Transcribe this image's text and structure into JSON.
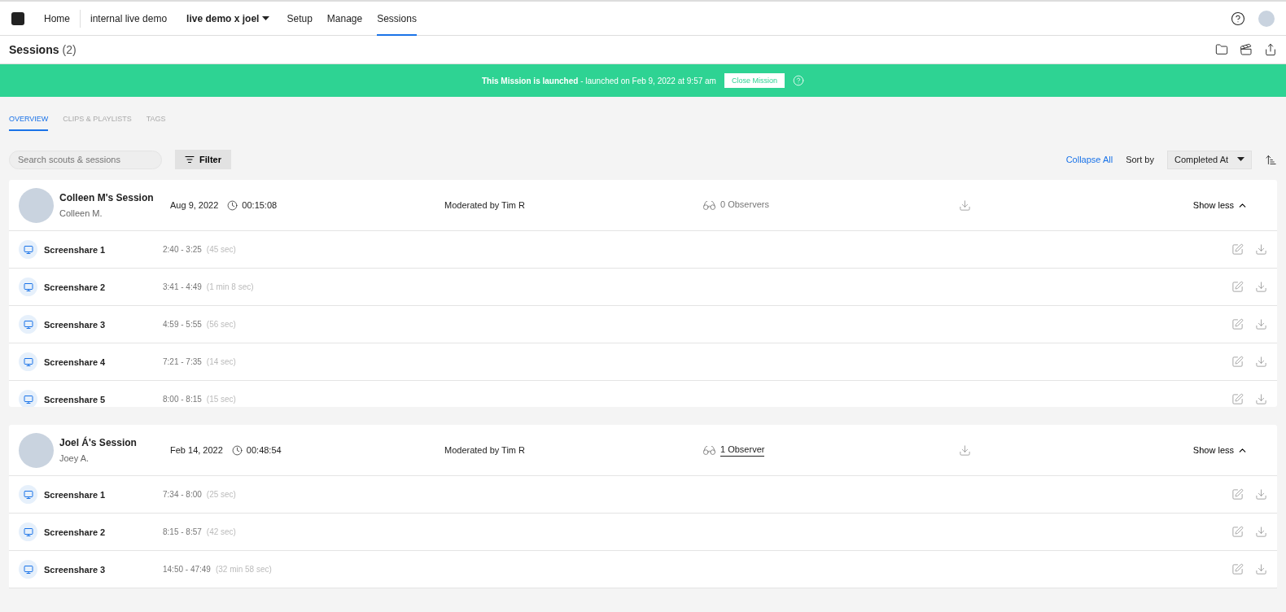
{
  "nav": {
    "home": "Home",
    "project": "internal live demo",
    "mission": "live demo x joel",
    "items": [
      {
        "label": "Setup",
        "selected": false
      },
      {
        "label": "Manage",
        "selected": false
      },
      {
        "label": "Sessions",
        "selected": true
      }
    ]
  },
  "header": {
    "title": "Sessions",
    "count": "(2)"
  },
  "banner": {
    "headline": "This Mission is launched",
    "detail": " - launched on Feb 9, 2022 at 9:57 am",
    "button": "Close Mission"
  },
  "tabs": [
    {
      "label": "OVERVIEW",
      "selected": true
    },
    {
      "label": "CLIPS & PLAYLISTS",
      "selected": false
    },
    {
      "label": "TAGS",
      "selected": false
    }
  ],
  "toolbar": {
    "search_placeholder": "Search scouts & sessions",
    "filter": "Filter",
    "collapse": "Collapse All",
    "sort_label": "Sort by",
    "sort_value": "Completed At"
  },
  "sessions": [
    {
      "title": "Colleen M's Session",
      "person": "Colleen M.",
      "date": "Aug 9, 2022",
      "duration": "00:15:08",
      "moderator": "Moderated by Tim R",
      "observers": "0 Observers",
      "observers_linked": false,
      "toggle": "Show less",
      "clips": [
        {
          "name": "Screenshare 1",
          "range": "2:40 - 3:25",
          "length": "(45 sec)"
        },
        {
          "name": "Screenshare 2",
          "range": "3:41 - 4:49",
          "length": "(1 min 8 sec)"
        },
        {
          "name": "Screenshare 3",
          "range": "4:59 - 5:55",
          "length": "(56 sec)"
        },
        {
          "name": "Screenshare 4",
          "range": "7:21 - 7:35",
          "length": "(14 sec)"
        },
        {
          "name": "Screenshare 5",
          "range": "8:00 - 8:15",
          "length": "(15 sec)"
        }
      ]
    },
    {
      "title": "Joel Á's Session",
      "person": "Joey A.",
      "date": "Feb 14, 2022",
      "duration": "00:48:54",
      "moderator": "Moderated by Tim R",
      "observers": "1 Observer",
      "observers_linked": true,
      "toggle": "Show less",
      "clips": [
        {
          "name": "Screenshare 1",
          "range": "7:34 - 8:00",
          "length": "(25 sec)"
        },
        {
          "name": "Screenshare 2",
          "range": "8:15 - 8:57",
          "length": "(42 sec)"
        },
        {
          "name": "Screenshare 3",
          "range": "14:50 - 47:49",
          "length": "(32 min 58 sec)"
        }
      ]
    }
  ]
}
